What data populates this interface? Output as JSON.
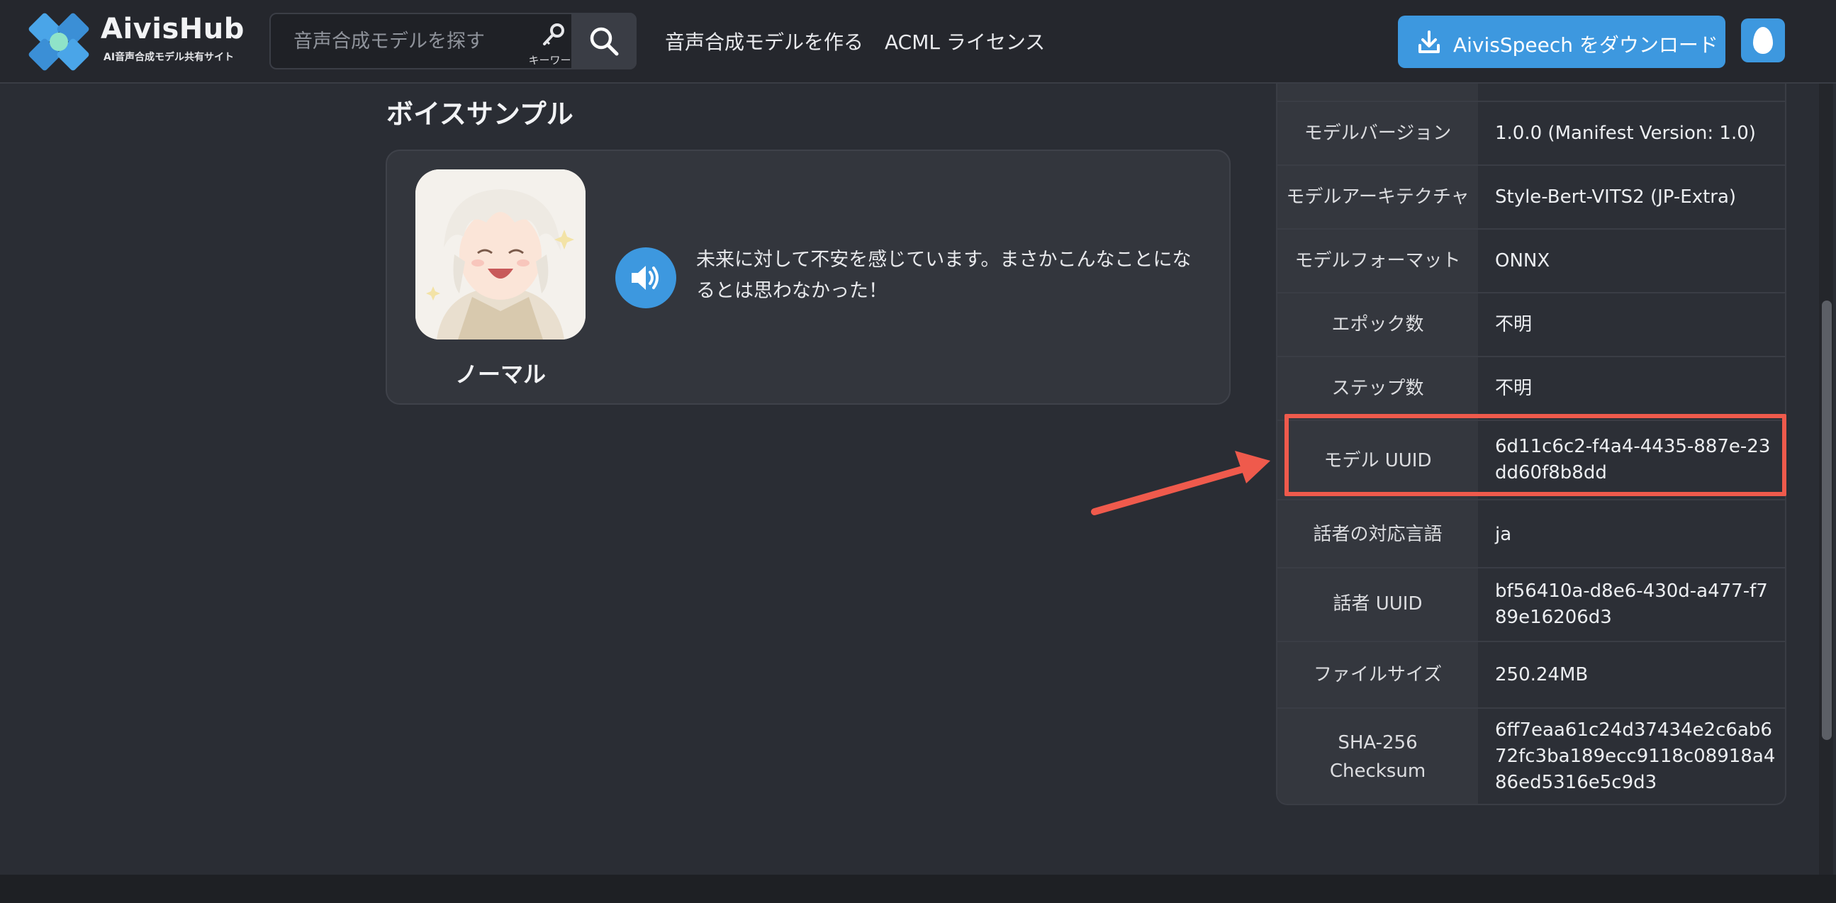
{
  "header": {
    "brand_name": "AivisHub",
    "brand_sub": "AI音声合成モデル共有サイト",
    "search": {
      "placeholder": "音声合成モデルを探す",
      "keyword_label": "キーワード"
    },
    "nav": [
      {
        "label": "音声合成モデルを作る"
      },
      {
        "label": "ACML ライセンス"
      }
    ],
    "download_label": "AivisSpeech をダウンロード",
    "accent_color": "#3d98df"
  },
  "voice_sample": {
    "title": "ボイスサンプル",
    "style_name": "ノーマル",
    "text": "未来に対して不安を感じています。まさかこんなことになるとは思わなかった！"
  },
  "info_table": [
    {
      "label": "モデルバージョン",
      "value": "1.0.0 (Manifest Version: 1.0)"
    },
    {
      "label": "モデルアーキテクチャ",
      "value": "Style-Bert-VITS2 (JP-Extra)"
    },
    {
      "label": "モデルフォーマット",
      "value": "ONNX"
    },
    {
      "label": "エポック数",
      "value": "不明"
    },
    {
      "label": "ステップ数",
      "value": "不明"
    },
    {
      "label": "モデル UUID",
      "value": "6d11c6c2-f4a4-4435-887e-23dd60f8b8dd"
    },
    {
      "label": "話者の対応言語",
      "value": "ja"
    },
    {
      "label": "話者 UUID",
      "value": "bf56410a-d8e6-430d-a477-f789e16206d3"
    },
    {
      "label": "ファイルサイズ",
      "value": "250.24MB"
    },
    {
      "label": "SHA-256 Checksum",
      "value": "6ff7eaa61c24d37434e2c6ab672fc3ba189ecc9118c08918a486ed5316e5c9d3"
    }
  ],
  "annotation_color": "#ef5a4c"
}
